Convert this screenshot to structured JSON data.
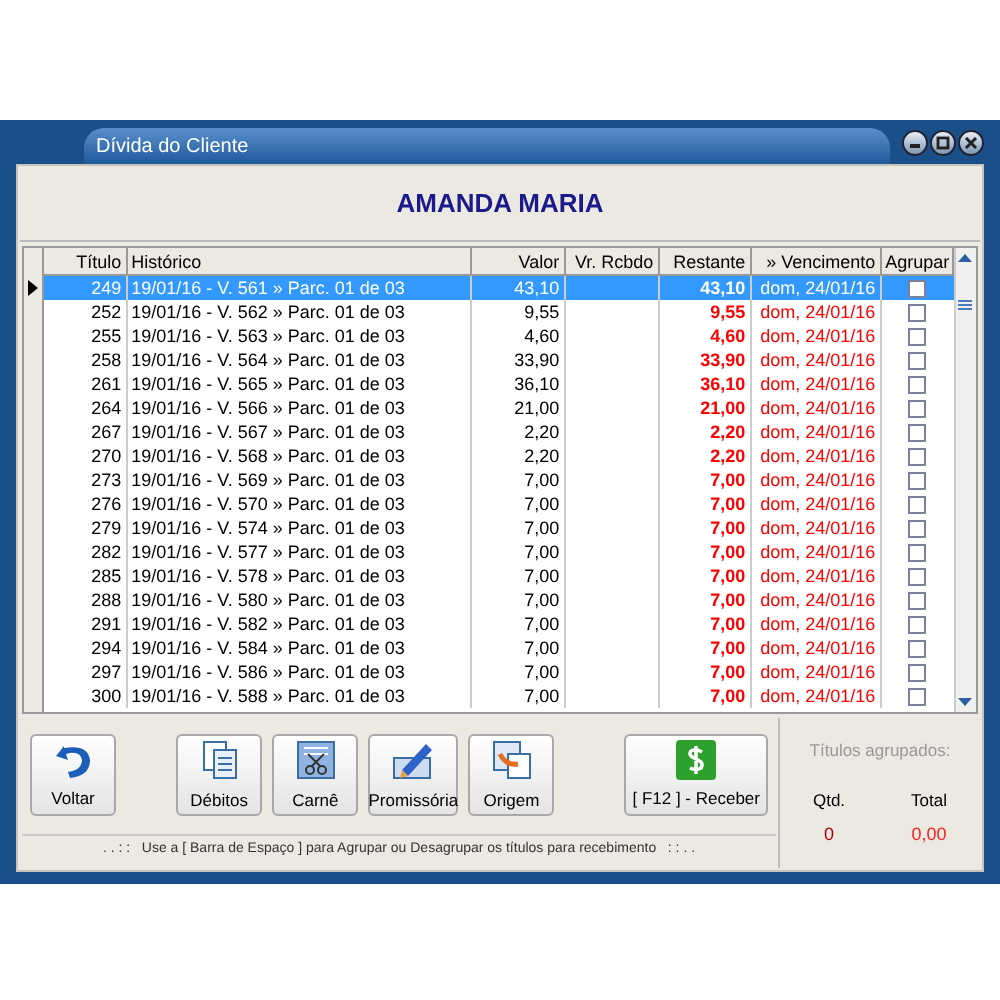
{
  "window": {
    "title": "Dívida do Cliente"
  },
  "customer": "AMANDA MARIA",
  "table": {
    "columns": [
      "Título",
      "Histórico",
      "Valor",
      "Vr. Rcbdo",
      "Restante",
      "» Vencimento",
      "Agrupar"
    ],
    "rows": [
      {
        "titulo": "249",
        "historico": "19/01/16 - V. 561 » Parc. 01 de 03",
        "valor": "43,10",
        "restante": "43,10",
        "vencimento": "dom, 24/01/16",
        "checked": false,
        "selected": true
      },
      {
        "titulo": "252",
        "historico": "19/01/16 - V. 562 » Parc. 01 de 03",
        "valor": "9,55",
        "restante": "9,55",
        "vencimento": "dom, 24/01/16",
        "checked": false,
        "selected": false
      },
      {
        "titulo": "255",
        "historico": "19/01/16 - V. 563 » Parc. 01 de 03",
        "valor": "4,60",
        "restante": "4,60",
        "vencimento": "dom, 24/01/16",
        "checked": false,
        "selected": false
      },
      {
        "titulo": "258",
        "historico": "19/01/16 - V. 564 » Parc. 01 de 03",
        "valor": "33,90",
        "restante": "33,90",
        "vencimento": "dom, 24/01/16",
        "checked": false,
        "selected": false
      },
      {
        "titulo": "261",
        "historico": "19/01/16 - V. 565 » Parc. 01 de 03",
        "valor": "36,10",
        "restante": "36,10",
        "vencimento": "dom, 24/01/16",
        "checked": false,
        "selected": false
      },
      {
        "titulo": "264",
        "historico": "19/01/16 - V. 566 » Parc. 01 de 03",
        "valor": "21,00",
        "restante": "21,00",
        "vencimento": "dom, 24/01/16",
        "checked": false,
        "selected": false
      },
      {
        "titulo": "267",
        "historico": "19/01/16 - V. 567 » Parc. 01 de 03",
        "valor": "2,20",
        "restante": "2,20",
        "vencimento": "dom, 24/01/16",
        "checked": false,
        "selected": false
      },
      {
        "titulo": "270",
        "historico": "19/01/16 - V. 568 » Parc. 01 de 03",
        "valor": "2,20",
        "restante": "2,20",
        "vencimento": "dom, 24/01/16",
        "checked": false,
        "selected": false
      },
      {
        "titulo": "273",
        "historico": "19/01/16 - V. 569 » Parc. 01 de 03",
        "valor": "7,00",
        "restante": "7,00",
        "vencimento": "dom, 24/01/16",
        "checked": false,
        "selected": false
      },
      {
        "titulo": "276",
        "historico": "19/01/16 - V. 570 » Parc. 01 de 03",
        "valor": "7,00",
        "restante": "7,00",
        "vencimento": "dom, 24/01/16",
        "checked": false,
        "selected": false
      },
      {
        "titulo": "279",
        "historico": "19/01/16 - V. 574 » Parc. 01 de 03",
        "valor": "7,00",
        "restante": "7,00",
        "vencimento": "dom, 24/01/16",
        "checked": false,
        "selected": false
      },
      {
        "titulo": "282",
        "historico": "19/01/16 - V. 577 » Parc. 01 de 03",
        "valor": "7,00",
        "restante": "7,00",
        "vencimento": "dom, 24/01/16",
        "checked": false,
        "selected": false
      },
      {
        "titulo": "285",
        "historico": "19/01/16 - V. 578 » Parc. 01 de 03",
        "valor": "7,00",
        "restante": "7,00",
        "vencimento": "dom, 24/01/16",
        "checked": false,
        "selected": false
      },
      {
        "titulo": "288",
        "historico": "19/01/16 - V. 580 » Parc. 01 de 03",
        "valor": "7,00",
        "restante": "7,00",
        "vencimento": "dom, 24/01/16",
        "checked": false,
        "selected": false
      },
      {
        "titulo": "291",
        "historico": "19/01/16 - V. 582 » Parc. 01 de 03",
        "valor": "7,00",
        "restante": "7,00",
        "vencimento": "dom, 24/01/16",
        "checked": false,
        "selected": false
      },
      {
        "titulo": "294",
        "historico": "19/01/16 - V. 584 » Parc. 01 de 03",
        "valor": "7,00",
        "restante": "7,00",
        "vencimento": "dom, 24/01/16",
        "checked": false,
        "selected": false
      },
      {
        "titulo": "297",
        "historico": "19/01/16 - V. 586 » Parc. 01 de 03",
        "valor": "7,00",
        "restante": "7,00",
        "vencimento": "dom, 24/01/16",
        "checked": false,
        "selected": false
      },
      {
        "titulo": "300",
        "historico": "19/01/16 - V. 588 » Parc. 01 de 03",
        "valor": "7,00",
        "restante": "7,00",
        "vencimento": "dom, 24/01/16",
        "checked": false,
        "selected": false
      }
    ]
  },
  "buttons": [
    {
      "kind": "undo",
      "label": "Voltar"
    },
    {
      "kind": "documents",
      "label": "Débitos"
    },
    {
      "kind": "carne",
      "label": "Carnê"
    },
    {
      "kind": "pen",
      "label": "Promissória"
    },
    {
      "kind": "origin",
      "label": "Origem"
    },
    {
      "kind": "money",
      "label": "[ F12 ] - Receber"
    }
  ],
  "hint": ". . : :   Use a [ Barra de Espaço ] para Agrupar ou Desagrupar os títulos para recebimento   : : . .",
  "summary": {
    "title": "Títulos agrupados:",
    "qtd_label": "Qtd.",
    "total_label": "Total",
    "qtd": "0",
    "total": "0,00"
  }
}
